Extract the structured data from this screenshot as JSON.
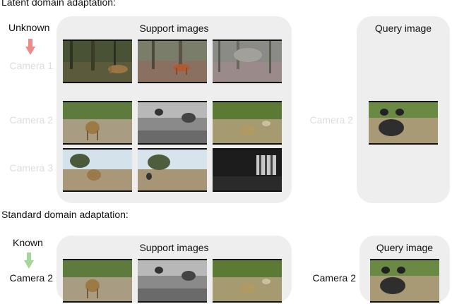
{
  "latent": {
    "heading": "Latent domain adaptation:",
    "status_label": "Unknown",
    "support_title": "Support images",
    "query_title": "Query image",
    "cameras": [
      "Camera 1",
      "Camera 2",
      "Camera 3"
    ],
    "query_camera": "Camera 2"
  },
  "standard": {
    "heading": "Standard domain adaptation:",
    "status_label": "Known",
    "support_title": "Support images",
    "query_title": "Query image",
    "camera": "Camera 2",
    "query_camera": "Camera 2"
  },
  "colors": {
    "unknown_arrow": "#f08a8a",
    "known_arrow": "#a6d79a",
    "panel_bg": "#eeeeee",
    "faded_text": "#dddddd"
  }
}
